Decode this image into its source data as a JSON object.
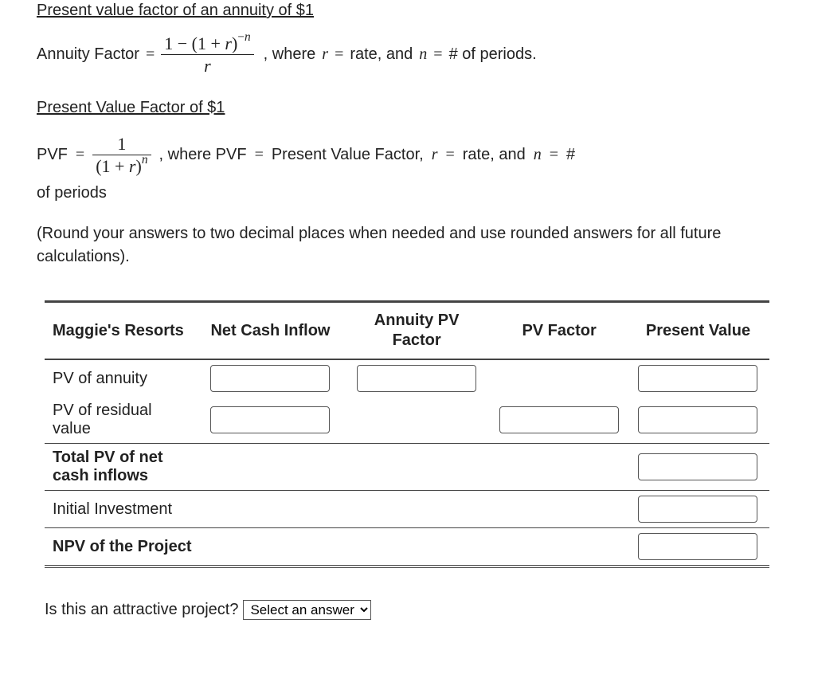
{
  "section1": {
    "title": "Present value factor of an annuity of $1",
    "lhs": "Annuity Factor",
    "trail": ", where",
    "r_lbl": "r",
    "eq1": "=",
    "rate": "rate, and",
    "n_lbl": "n",
    "eq2": "=",
    "nper": "# of periods."
  },
  "section2": {
    "title": "Present Value Factor of $1",
    "lhs": "PVF",
    "trail": ", where PVF",
    "pvf_txt": "Present Value Factor,",
    "r_lbl": "r",
    "rate": "rate, and",
    "n_lbl": "n",
    "hash": "#",
    "of_periods": "of periods"
  },
  "round_note": "(Round your answers to two decimal places when needed and use rounded answers for all future calculations).",
  "table": {
    "headers": {
      "c1": "Maggie's Resorts",
      "c2": "Net Cash Inflow",
      "c3": "Annuity PV Factor",
      "c4": "PV Factor",
      "c5": "Present Value"
    },
    "rows": {
      "r1": "PV of annuity",
      "r2": "PV of residual value",
      "r3": "Total PV of net cash inflows",
      "r4": "Initial Investment",
      "r5": "NPV of the Project"
    }
  },
  "question": {
    "q": "Is this an attractive project?",
    "placeholder": "Select an answer"
  }
}
